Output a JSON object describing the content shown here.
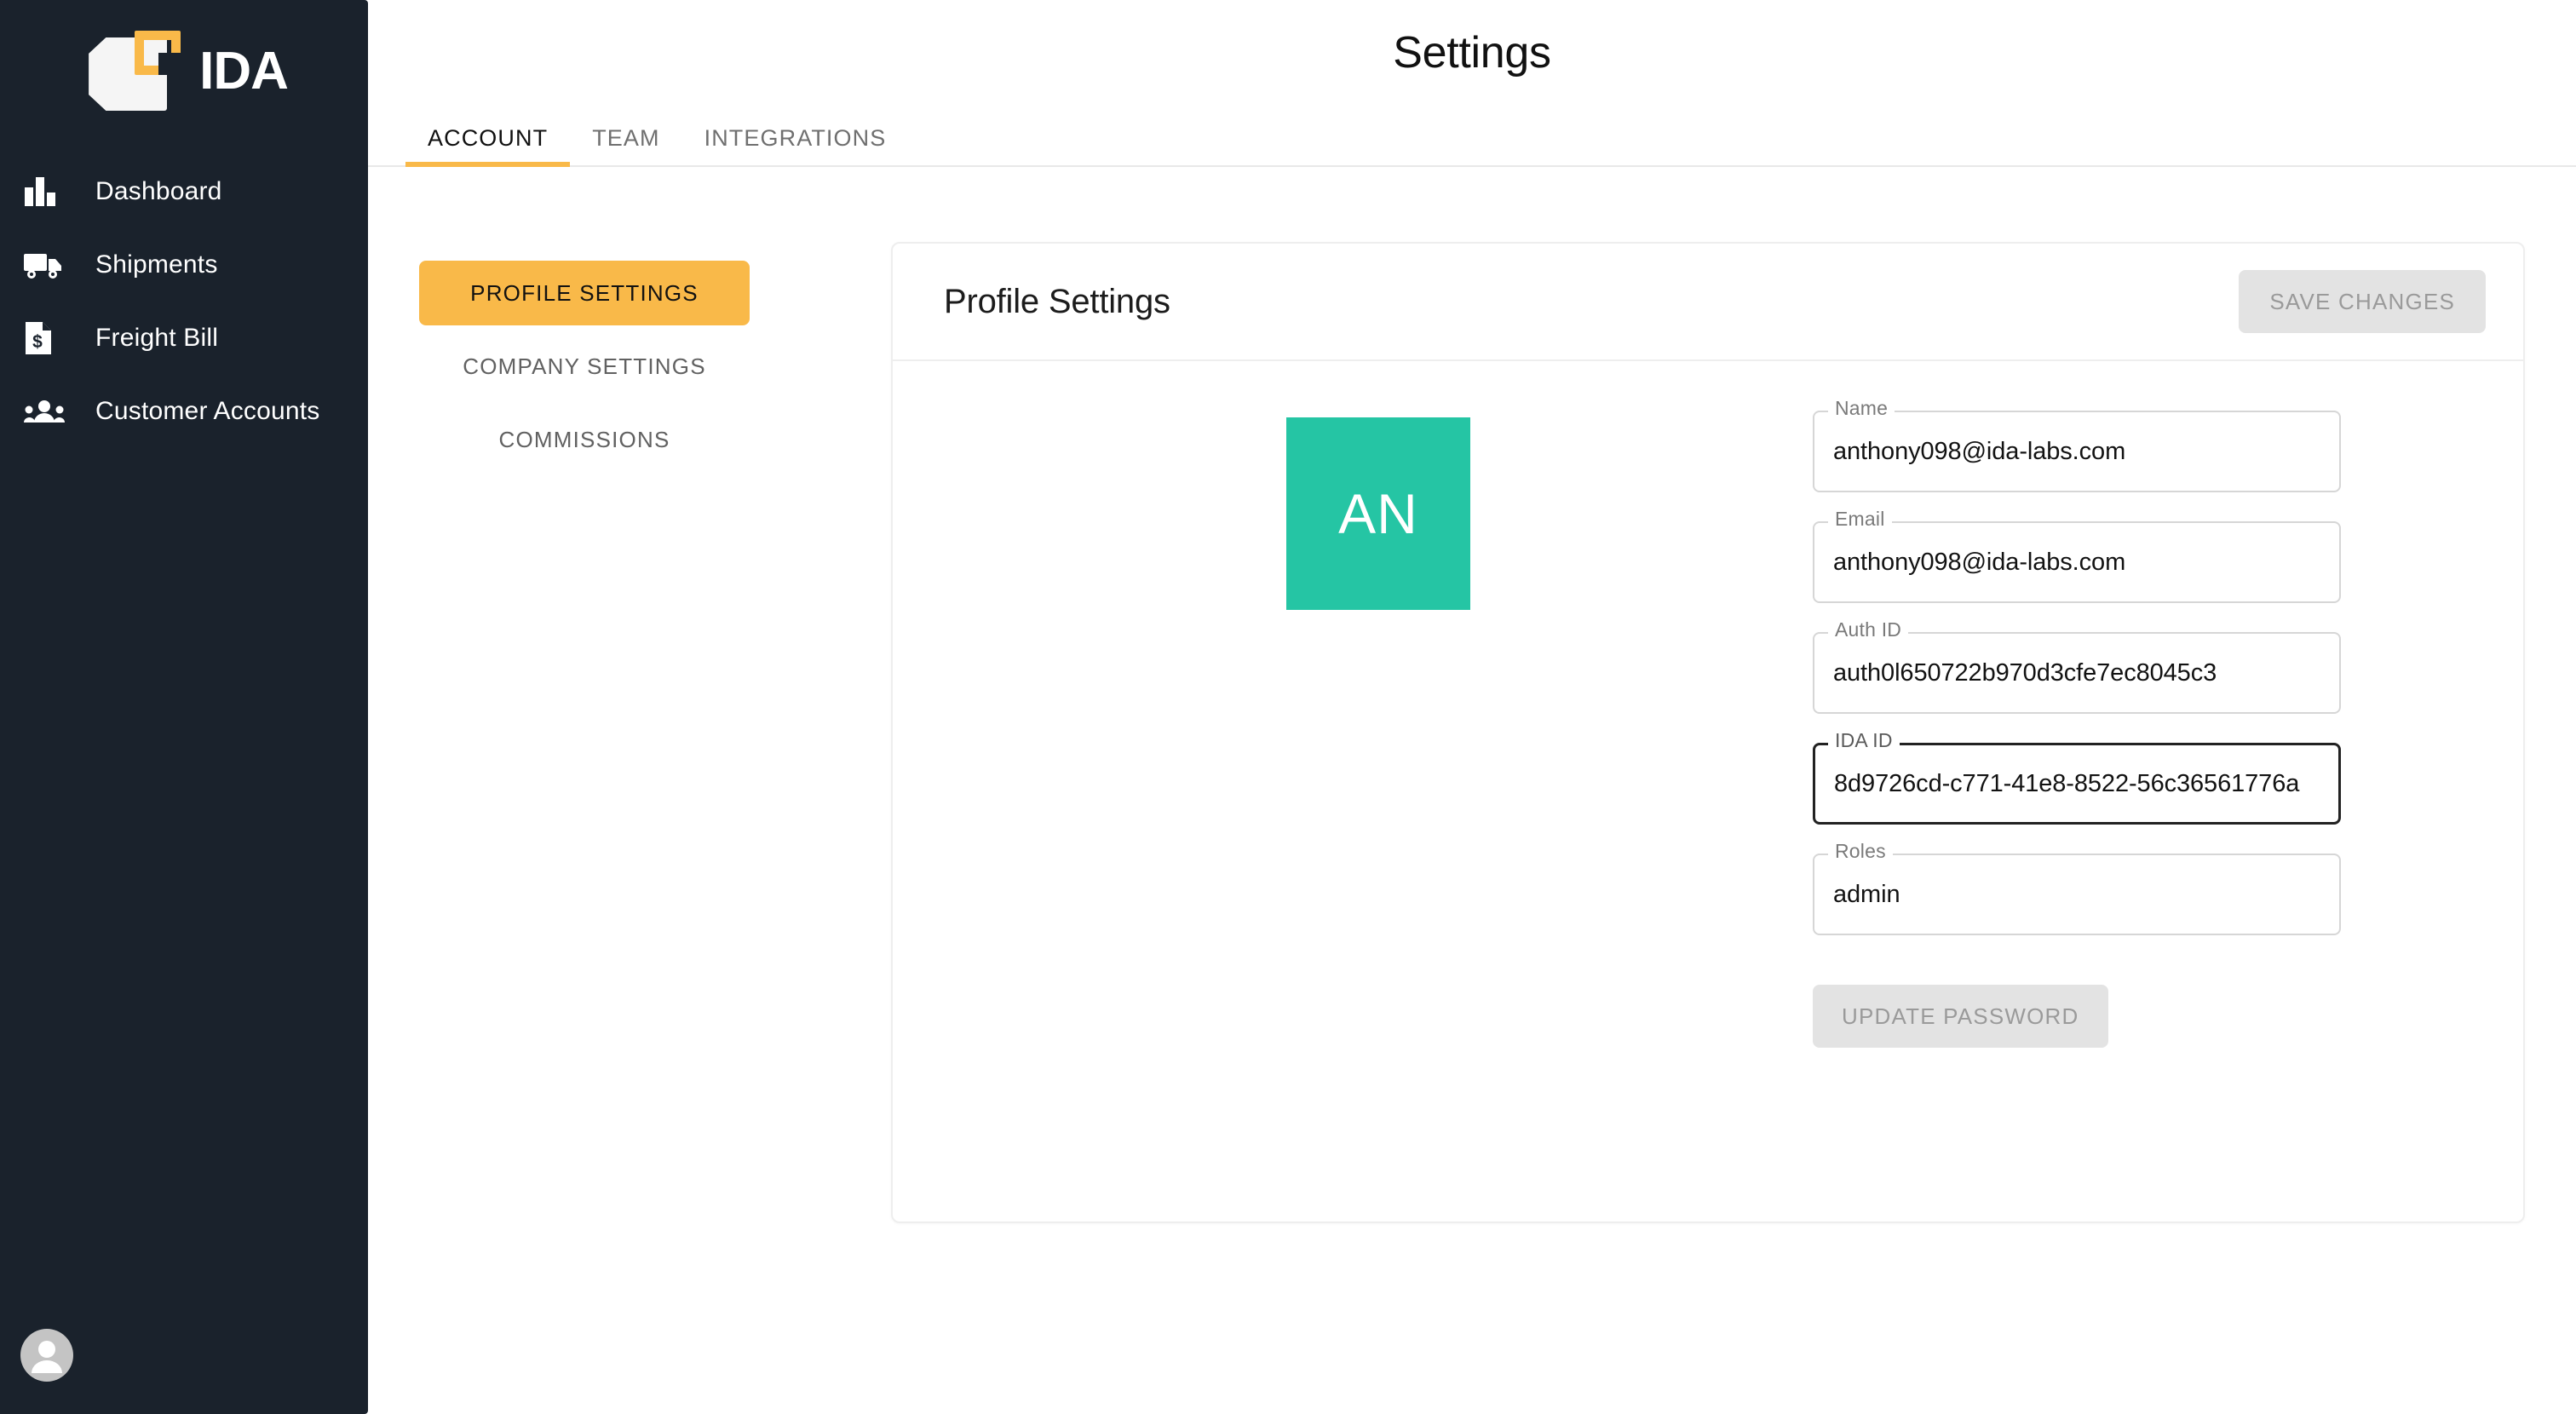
{
  "brand": {
    "name": "IDA",
    "logo_icon": "ida-logo-icon",
    "accent_color": "#F9B949",
    "sidebar_color": "#1a222c"
  },
  "sidebar": {
    "items": [
      {
        "label": "Dashboard",
        "icon": "bar-chart-icon"
      },
      {
        "label": "Shipments",
        "icon": "truck-icon"
      },
      {
        "label": "Freight Bill",
        "icon": "invoice-dollar-icon"
      },
      {
        "label": "Customer Accounts",
        "icon": "people-group-icon"
      }
    ],
    "user_avatar_icon": "user-circle-icon"
  },
  "header": {
    "title": "Settings"
  },
  "tabs": [
    {
      "label": "ACCOUNT",
      "active": true
    },
    {
      "label": "TEAM",
      "active": false
    },
    {
      "label": "INTEGRATIONS",
      "active": false
    }
  ],
  "subnav": [
    {
      "label": "PROFILE SETTINGS",
      "active": true
    },
    {
      "label": "COMPANY SETTINGS",
      "active": false
    },
    {
      "label": "COMMISSIONS",
      "active": false
    }
  ],
  "card": {
    "title": "Profile Settings",
    "save_button": "SAVE CHANGES",
    "avatar": {
      "initials": "AN",
      "color": "#25C5A4"
    },
    "fields": [
      {
        "label": "Name",
        "value": "anthony098@ida-labs.com",
        "focused": false
      },
      {
        "label": "Email",
        "value": "anthony098@ida-labs.com",
        "focused": false
      },
      {
        "label": "Auth ID",
        "value": "auth0l650722b970d3cfe7ec8045c3",
        "focused": false
      },
      {
        "label": "IDA ID",
        "value": "8d9726cd-c771-41e8-8522-56c36561776a",
        "focused": true
      },
      {
        "label": "Roles",
        "value": "admin",
        "focused": false
      }
    ],
    "update_password_button": "UPDATE PASSWORD"
  }
}
